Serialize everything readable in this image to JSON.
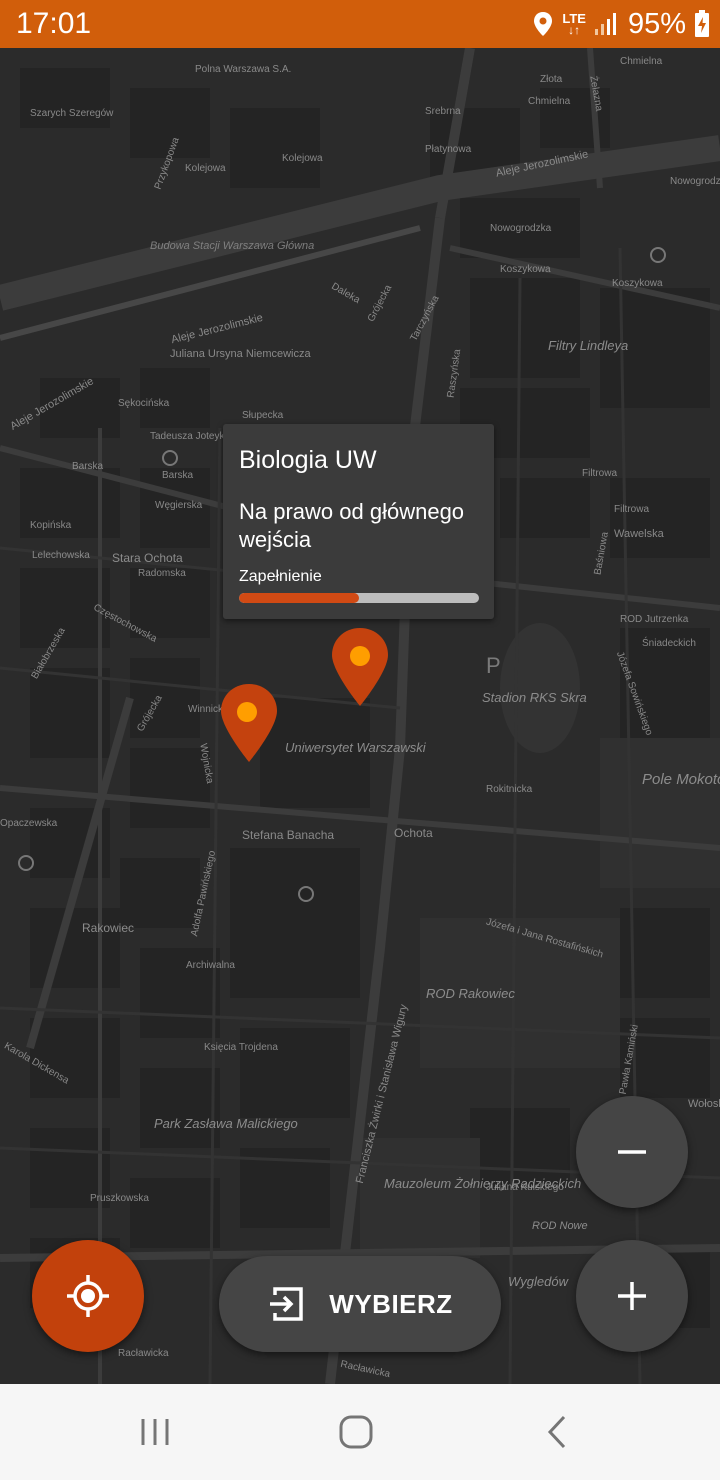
{
  "status_bar": {
    "time": "17:01",
    "network": "LTE",
    "battery": "95%",
    "accent_color": "#d15e0b"
  },
  "map": {
    "streets": [
      "Polna Warszawa S.A.",
      "Szarych Szeregów",
      "Przykopowa",
      "Kolejowa",
      "Kolejowa",
      "Budowa Stacji Warszawa Główna",
      "Srebrna",
      "Chmielna",
      "Złota",
      "Żelazna",
      "Chmielna",
      "Płatynowa",
      "Aleje Jerozolimskie",
      "Aleje Jerozolimskie",
      "Nowogrodzka",
      "Nowogrodzka",
      "Koszykowa",
      "Koszykowa",
      "Filtry Lindleya",
      "Juliana Ursyna Niemcewicza",
      "Aleje Jerozolimskie",
      "Dalekа",
      "Grójecka",
      "Tarczyńska",
      "Raszyńska",
      "Sękocińska",
      "Słupecka",
      "Tadeusza Joteyki",
      "Barska",
      "Barska",
      "Węgierska",
      "Filtrowa",
      "Filtrowa",
      "Wawelska",
      "Kopińska",
      "Lelechowska",
      "Stara Ochota",
      "Radomska",
      "Częstochowska",
      "Białobrzeska",
      "Grójecka",
      "Winnicka",
      "Wojnicka",
      "Uniwersytet Warszawski",
      "Stadion RKS Skra",
      "Rokitnicka",
      "Pole Mokotowskie",
      "Ochota",
      "Stefana Banacha",
      "Opaczewska",
      "Rakowiec",
      "Adolfa Pawińskiego",
      "Archiwalna",
      "Józefa i Jana Rostafińskich",
      "ROD Rakowiec",
      "Karola Dickensa",
      "Księcia Trojdena",
      "Park Zasława Malickiego",
      "Franciszka Żwirki i Stanisława Wigury",
      "Mauzoleum Żołnierzy Radzieckich",
      "Juliana Kulskiego",
      "ROD Nowe",
      "Pruszkowska",
      "Racławicka",
      "Racławicka",
      "Wygledów",
      "Baśniowa",
      "ROD Jutrzenka",
      "Śniadeckich",
      "Józefa Sowińskiego",
      "Pawła Kamiński",
      "Wołoska"
    ]
  },
  "popup": {
    "title": "Biologia UW",
    "description": "Na prawo od głównego wejścia",
    "fill_label": "Zapełnienie",
    "fill_level": 0.5
  },
  "pins": [
    {
      "name": "parking-pin-1",
      "color": "#c4420e",
      "dot": "#ff9e00"
    },
    {
      "name": "parking-pin-2",
      "color": "#c4420e",
      "dot": "#ff9e00"
    }
  ],
  "buttons": {
    "locate_icon": "crosshair-icon",
    "select_label": "WYBIERZ",
    "select_icon": "login-icon",
    "zoom_out_icon": "minus-icon",
    "zoom_in_icon": "plus-icon",
    "locate_color": "#c2410c",
    "button_color": "#454545"
  },
  "nav_bar": {
    "recents_icon": "recents-icon",
    "home_icon": "home-icon",
    "back_icon": "back-icon"
  }
}
